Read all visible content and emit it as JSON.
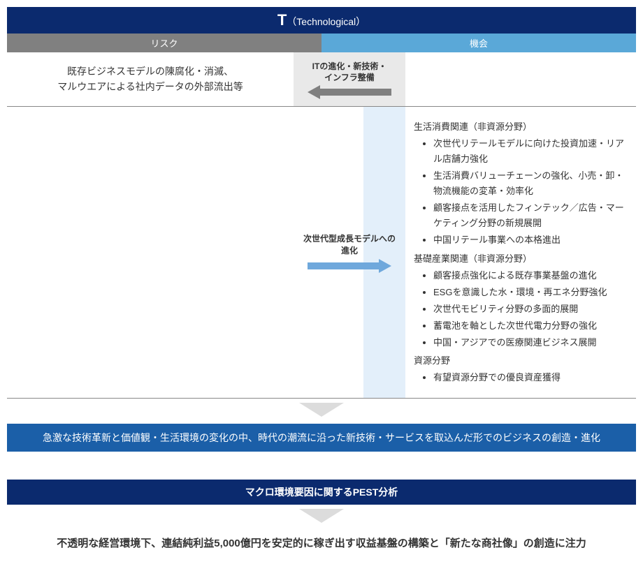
{
  "header": {
    "abbr": "T",
    "paren": "（Technological）"
  },
  "subheaders": {
    "risk": "リスク",
    "opportunity": "機会"
  },
  "row1": {
    "risk_text": "既存ビジネスモデルの陳腐化・消滅、\nマルウエアによる社内データの外部流出等",
    "driver": "ITの進化・新技術・\nインフラ整備"
  },
  "row2": {
    "driver": "次世代型成長モデルへの\n進化",
    "sections": [
      {
        "title": "生活消費関連（非資源分野）",
        "items": [
          "次世代リテールモデルに向けた投資加速・リアル店舗力強化",
          "生活消費バリューチェーンの強化、小売・卸・物流機能の変革・効率化",
          "顧客接点を活用したフィンテック／広告・マーケティング分野の新規展開",
          "中国リテール事業への本格進出"
        ]
      },
      {
        "title": "基礎産業関連（非資源分野）",
        "items": [
          "顧客接点強化による既存事業基盤の進化",
          "ESGを意識した水・環境・再エネ分野強化",
          "次世代モビリティ分野の多面的展開",
          "蓄電池を軸とした次世代電力分野の強化",
          "中国・アジアでの医療関連ビジネス展開"
        ]
      },
      {
        "title": "資源分野",
        "items": [
          "有望資源分野での優良資産獲得"
        ]
      }
    ]
  },
  "summary": "急激な技術革新と価値観・生活環境の変化の中、時代の潮流に沿った新技術・サービスを取込んだ形でのビジネスの創造・進化",
  "macro_title": "マクロ環境要因に関するPEST分析",
  "final": "不透明な経営環境下、連結純利益5,000億円を安定的に稼ぎ出す収益基盤の構築と「新たな商社像」の創造に注力"
}
